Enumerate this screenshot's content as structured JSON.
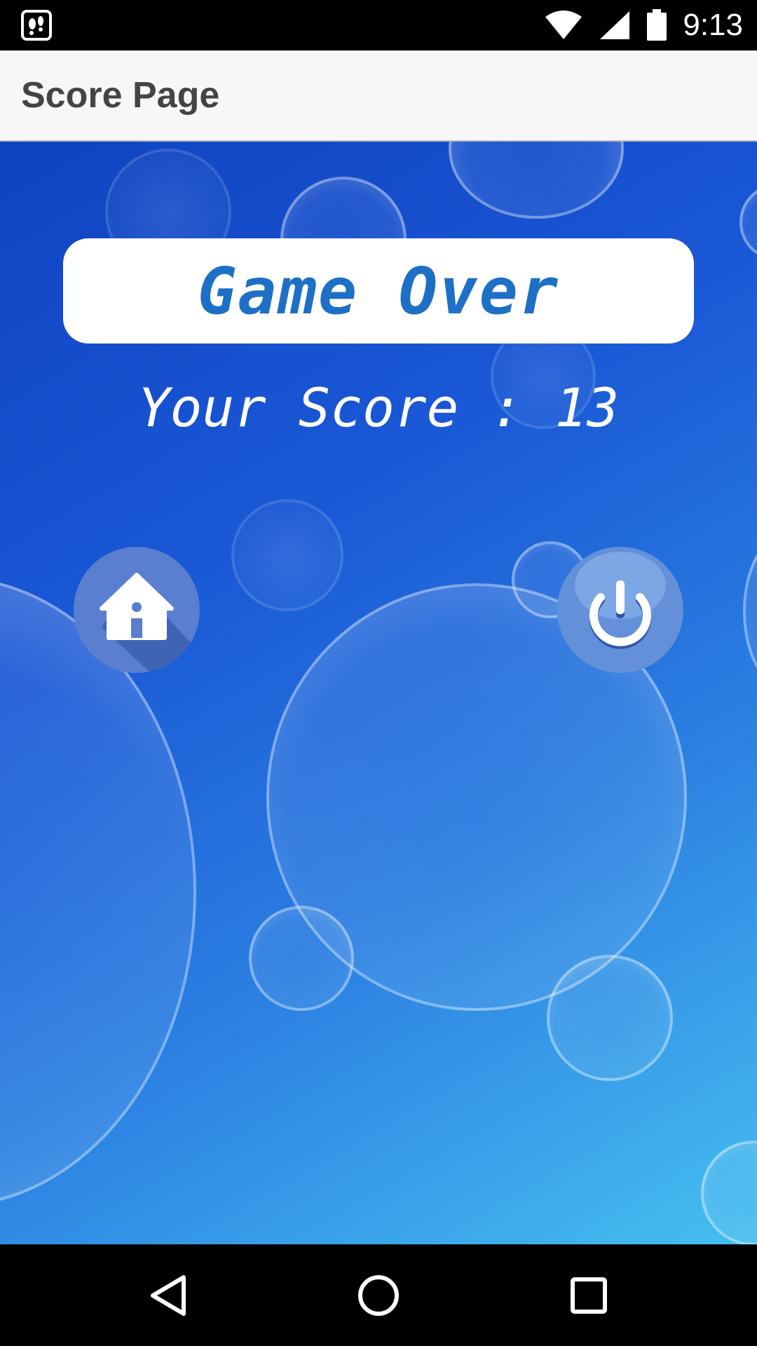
{
  "status_bar": {
    "time": "9:13",
    "icons": [
      "app-notification-icon",
      "wifi-icon",
      "cell-signal-icon",
      "battery-icon"
    ]
  },
  "app_bar": {
    "title": "Score Page"
  },
  "game_over": {
    "title": "Game Over",
    "score_text": "Your Score : 13"
  },
  "actions": {
    "home_icon": "home-icon",
    "power_icon": "power-icon"
  },
  "nav_bar": {
    "icons": [
      "back-icon",
      "home-circle-icon",
      "recents-icon"
    ]
  },
  "colors": {
    "title_text": "#1e6fc6",
    "background_top": "#0f43c0",
    "background_bottom": "#46bff0"
  }
}
